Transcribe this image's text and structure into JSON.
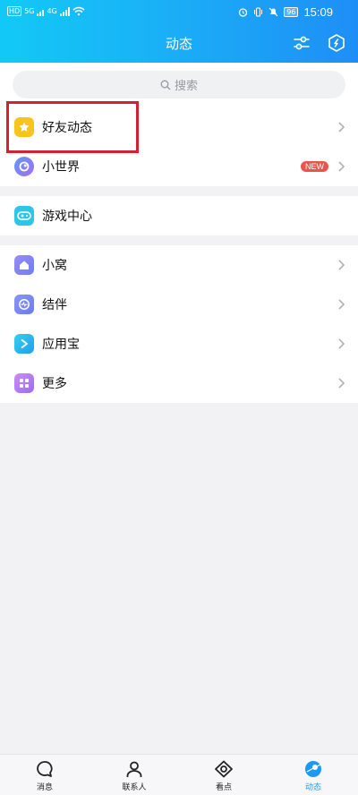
{
  "statusbar": {
    "left_labels": [
      "HD",
      "5G",
      "4G"
    ],
    "battery": "96",
    "time": "15:09"
  },
  "header": {
    "title": "动态",
    "settings_icon": "sliders-icon",
    "shield_icon": "hexagon-shield-icon"
  },
  "search": {
    "placeholder": "搜索",
    "icon": "search-icon"
  },
  "groups": [
    {
      "items": [
        {
          "label": "好友动态",
          "icon": "star-icon",
          "color": "#f6c41b",
          "chevron": true
        },
        {
          "label": "小世界",
          "icon": "planet-icon",
          "color": "#7d6cf6",
          "badge": "NEW",
          "chevron": true
        }
      ]
    },
    {
      "items": [
        {
          "label": "游戏中心",
          "icon": "gamepad-icon",
          "color": "#2ec6e8",
          "chevron": false
        }
      ]
    },
    {
      "items": [
        {
          "label": "小窝",
          "icon": "house-icon",
          "color": "#8a7cf0",
          "chevron": true
        },
        {
          "label": "结伴",
          "icon": "chat-pulse-icon",
          "color": "#7a86f2",
          "chevron": true
        },
        {
          "label": "应用宝",
          "icon": "app-store-icon",
          "color": "#28c1e6",
          "chevron": true
        },
        {
          "label": "更多",
          "icon": "grid-icon",
          "color": "#b47cf2",
          "chevron": true
        }
      ]
    }
  ],
  "tabbar": [
    {
      "label": "消息",
      "icon": "chat-bubble-icon",
      "active": false
    },
    {
      "label": "联系人",
      "icon": "person-icon",
      "active": false
    },
    {
      "label": "看点",
      "icon": "eye-icon",
      "active": false
    },
    {
      "label": "动态",
      "icon": "planet-icon",
      "active": true
    }
  ],
  "colors": {
    "header_start": "#12c9f6",
    "header_end": "#1e8ef6",
    "active_tab": "#1e98f5",
    "highlight": "#d0232e",
    "badge": "#e9554a"
  }
}
